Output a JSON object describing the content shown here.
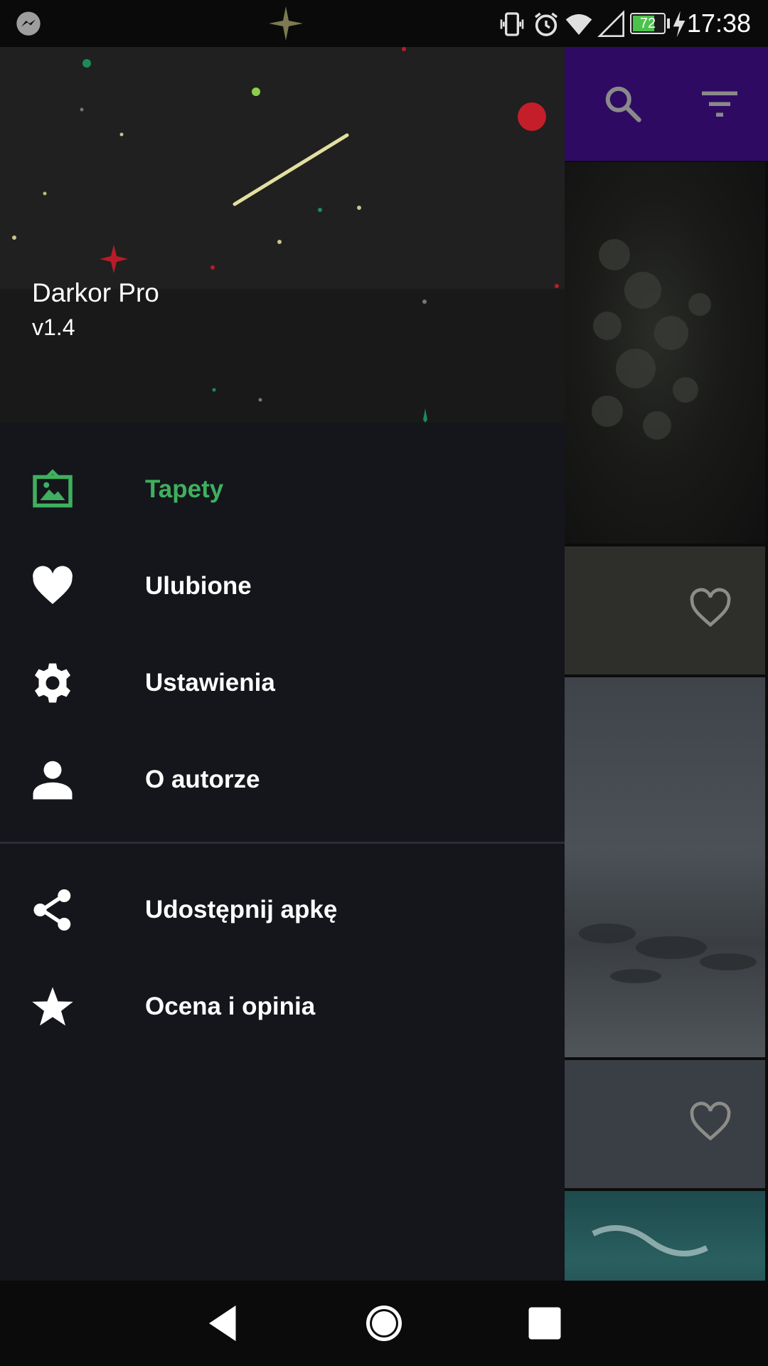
{
  "status_bar": {
    "time": "17:38",
    "battery": "72",
    "icons": [
      "messenger-icon",
      "vibrate-icon",
      "alarm-icon",
      "wifi-icon",
      "signal-icon",
      "battery-charging-icon"
    ]
  },
  "toolbar": {
    "actions": [
      "search-icon",
      "filter-icon"
    ]
  },
  "drawer": {
    "app_name": "Darkor Pro",
    "version": "v1.4",
    "accent_color": "#3fb05e",
    "items": [
      {
        "label": "Tapety",
        "icon": "wallpaper-icon",
        "active": true
      },
      {
        "label": "Ulubione",
        "icon": "heart-icon",
        "active": false
      },
      {
        "label": "Ustawienia",
        "icon": "gear-icon",
        "active": false
      },
      {
        "label": "O autorze",
        "icon": "person-icon",
        "active": false
      }
    ],
    "secondary_items": [
      {
        "label": "Udostępnij apkę",
        "icon": "share-icon"
      },
      {
        "label": "Ocena i opinia",
        "icon": "star-icon"
      }
    ]
  },
  "navigation_bar": {
    "buttons": [
      "back-icon",
      "home-icon",
      "recents-icon"
    ]
  }
}
